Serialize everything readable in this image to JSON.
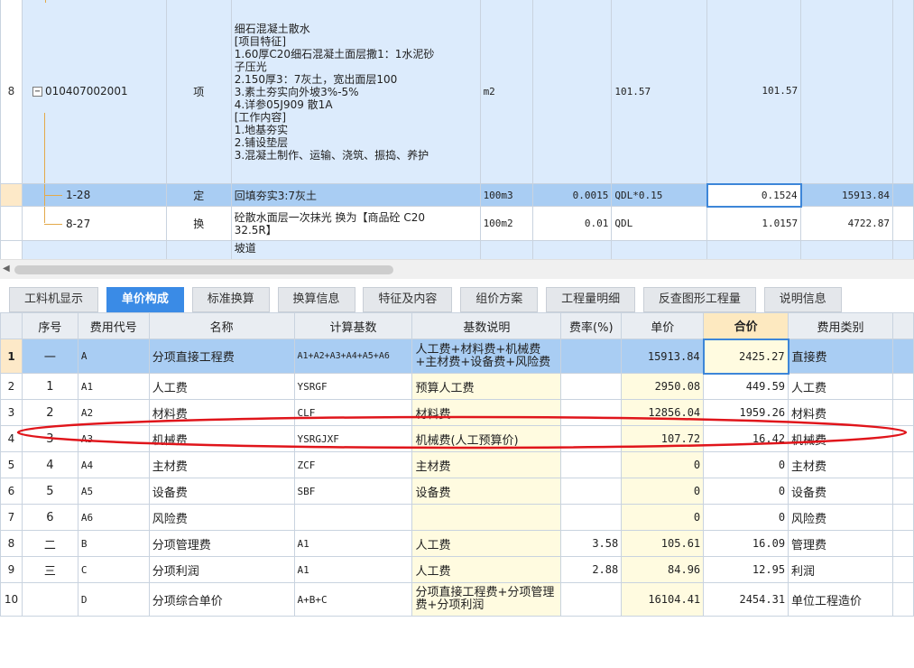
{
  "upper": {
    "item_row": {
      "row_no": "8",
      "expand_glyph": "−",
      "code": "010407002001",
      "type": "项",
      "desc_lines": [
        "细石混凝土散水",
        "[项目特征]",
        "1.60厚C20细石混凝土面层撒1：1水泥砂",
        "子压光",
        "2.150厚3：7灰土，宽出面层100",
        "3.素土夯实向外坡3%-5%",
        "4.详参05J909 散1A",
        "[工作内容]",
        "1.地基夯实",
        "2.铺设垫层",
        "3.混凝土制作、运输、浇筑、振捣、养护"
      ],
      "unit": "m2",
      "qty": "101.57",
      "total": "101.57"
    },
    "sub_rows": [
      {
        "code": "1-28",
        "type": "定",
        "desc": "回填夯实3:7灰土",
        "unit": "100m3",
        "content": "0.0015",
        "expr": "QDL*0.15",
        "qty": "0.1524",
        "price": "15913.84"
      },
      {
        "code": "8-27",
        "type": "换",
        "desc1": "砼散水面层一次抹光  换为【商品砼 C20",
        "desc2": "32.5R】",
        "unit": "100m2",
        "content": "0.01",
        "expr": "QDL",
        "qty": "1.0157",
        "price": "4722.87"
      }
    ],
    "next_row_desc": "坡道"
  },
  "scrollbar": {
    "left_arrow": "◀"
  },
  "tabs": [
    "工料机显示",
    "单价构成",
    "标准换算",
    "换算信息",
    "特征及内容",
    "组价方案",
    "工程量明细",
    "反查图形工程量",
    "说明信息"
  ],
  "active_tab": "单价构成",
  "lower": {
    "headers": [
      "",
      "序号",
      "费用代号",
      "名称",
      "计算基数",
      "基数说明",
      "费率(%)",
      "单价",
      "合价",
      "费用类别"
    ],
    "rows": [
      {
        "idx": "1",
        "seq": "一",
        "code": "A",
        "name": "分项直接工程费",
        "base": "A1+A2+A3+A4+A5+A6",
        "base_desc": "人工费+材料费+机械费+主材费+设备费+风险费",
        "rate": "",
        "unit_price": "15913.84",
        "total": "2425.27",
        "category": "直接费"
      },
      {
        "idx": "2",
        "seq": "1",
        "code": "A1",
        "name": "人工费",
        "base": "YSRGF",
        "base_desc": "预算人工费",
        "rate": "",
        "unit_price": "2950.08",
        "total": "449.59",
        "category": "人工费"
      },
      {
        "idx": "3",
        "seq": "2",
        "code": "A2",
        "name": "材料费",
        "base": "CLF",
        "base_desc": "材料费",
        "rate": "",
        "unit_price": "12856.04",
        "total": "1959.26",
        "category": "材料费"
      },
      {
        "idx": "4",
        "seq": "3",
        "code": "A3",
        "name": "机械费",
        "base": "YSRGJXF",
        "base_desc": "机械费(人工预算价)",
        "rate": "",
        "unit_price": "107.72",
        "total": "16.42",
        "category": "机械费"
      },
      {
        "idx": "5",
        "seq": "4",
        "code": "A4",
        "name": "主材费",
        "base": "ZCF",
        "base_desc": "主材费",
        "rate": "",
        "unit_price": "0",
        "total": "0",
        "category": "主材费"
      },
      {
        "idx": "6",
        "seq": "5",
        "code": "A5",
        "name": "设备费",
        "base": "SBF",
        "base_desc": "设备费",
        "rate": "",
        "unit_price": "0",
        "total": "0",
        "category": "设备费"
      },
      {
        "idx": "7",
        "seq": "6",
        "code": "A6",
        "name": "风险费",
        "base": "",
        "base_desc": "",
        "rate": "",
        "unit_price": "0",
        "total": "0",
        "category": "风险费"
      },
      {
        "idx": "8",
        "seq": "二",
        "code": "B",
        "name": "分项管理费",
        "base": "A1",
        "base_desc": "人工费",
        "rate": "3.58",
        "unit_price": "105.61",
        "total": "16.09",
        "category": "管理费"
      },
      {
        "idx": "9",
        "seq": "三",
        "code": "C",
        "name": "分项利润",
        "base": "A1",
        "base_desc": "人工费",
        "rate": "2.88",
        "unit_price": "84.96",
        "total": "12.95",
        "category": "利润"
      },
      {
        "idx": "10",
        "seq": "",
        "code": "D",
        "name": "分项综合单价",
        "base": "A+B+C",
        "base_desc": "分项直接工程费+分项管理费+分项利润",
        "rate": "",
        "unit_price": "16104.41",
        "total": "2454.31",
        "category": "单位工程造价"
      }
    ]
  },
  "colors": {
    "selected_row": "#a9cdf3",
    "item_row": "#dcebfc",
    "active_tab": "#3a8be6",
    "annotation_ellipse": "#e0151b",
    "yellow_cell": "#fffbe0"
  }
}
